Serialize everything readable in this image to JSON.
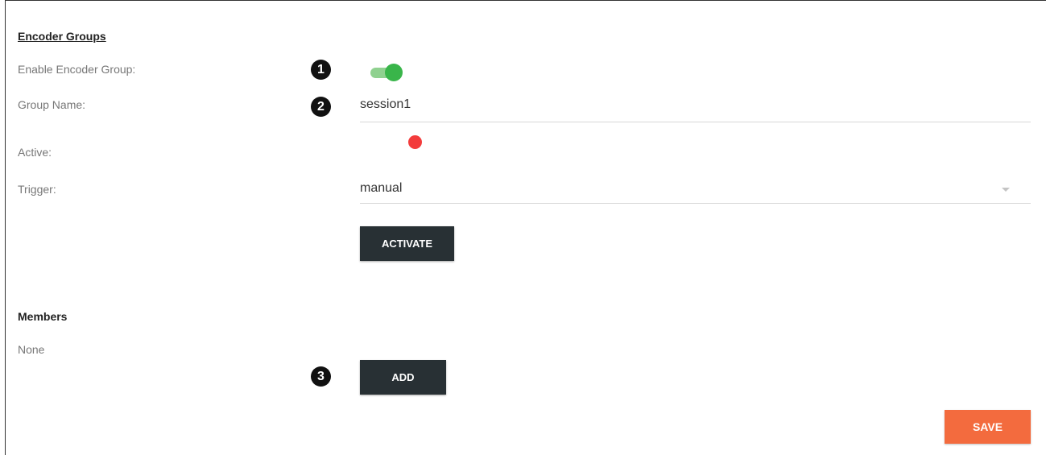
{
  "section_title": "Encoder Groups",
  "fields": {
    "enable_label": "Enable Encoder Group:",
    "group_name_label": "Group Name:",
    "group_name_value": "session1",
    "active_label": "Active:",
    "trigger_label": "Trigger:",
    "trigger_value": "manual"
  },
  "enable_state": "on",
  "active_state": "inactive",
  "buttons": {
    "activate": "ACTIVATE",
    "add": "ADD",
    "save": "SAVE"
  },
  "members": {
    "title": "Members",
    "empty_text": "None"
  },
  "callouts": [
    "1",
    "2",
    "3"
  ],
  "colors": {
    "toggle_on": "#39b54a",
    "active_indicator": "#f33c3c",
    "dark_button": "#283034",
    "save_button": "#f36b3e"
  }
}
